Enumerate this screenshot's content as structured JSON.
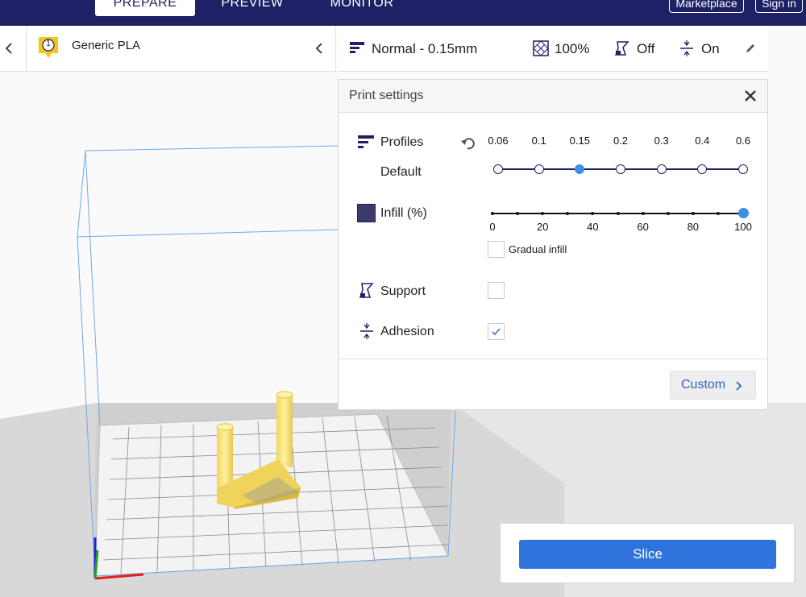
{
  "stages": {
    "prepare": "PREPARE",
    "preview": "PREVIEW",
    "monitor": "MONITOR"
  },
  "top_buttons": {
    "marketplace": "Marketplace",
    "signin": "Sign in"
  },
  "material": {
    "extruder_number": "1",
    "name": "Generic PLA"
  },
  "summary": {
    "profile": "Normal - 0.15mm",
    "infill": "100%",
    "support": "Off",
    "adhesion": "On"
  },
  "print_settings": {
    "title": "Print settings",
    "profiles": {
      "label": "Profiles",
      "sublabel": "Default",
      "options": [
        "0.06",
        "0.1",
        "0.15",
        "0.2",
        "0.3",
        "0.4",
        "0.6"
      ],
      "selected": "0.15"
    },
    "infill": {
      "label": "Infill (%)",
      "ticks": [
        "0",
        "20",
        "40",
        "60",
        "80",
        "100"
      ],
      "value": 100,
      "gradual_label": "Gradual infill",
      "gradual_checked": false
    },
    "support": {
      "label": "Support",
      "checked": false
    },
    "adhesion": {
      "label": "Adhesion",
      "checked": true
    },
    "custom_label": "Custom"
  },
  "slice": {
    "label": "Slice"
  },
  "colors": {
    "navy": "#1e2165",
    "accent_blue": "#3d8fe0",
    "slice_blue": "#2f74dd",
    "model_yellow": "#ffe77a"
  }
}
